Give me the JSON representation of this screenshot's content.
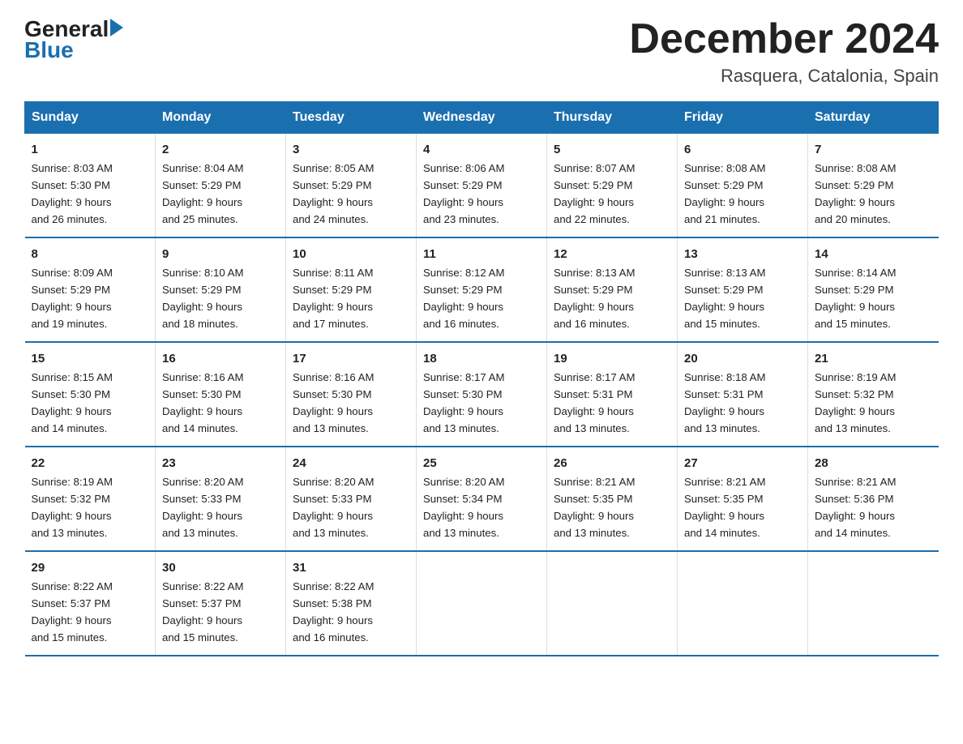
{
  "header": {
    "title": "December 2024",
    "subtitle": "Rasquera, Catalonia, Spain",
    "logo_general": "General",
    "logo_blue": "Blue"
  },
  "days_of_week": [
    "Sunday",
    "Monday",
    "Tuesday",
    "Wednesday",
    "Thursday",
    "Friday",
    "Saturday"
  ],
  "weeks": [
    [
      {
        "day": "1",
        "sunrise": "8:03 AM",
        "sunset": "5:30 PM",
        "daylight": "9 hours and 26 minutes."
      },
      {
        "day": "2",
        "sunrise": "8:04 AM",
        "sunset": "5:29 PM",
        "daylight": "9 hours and 25 minutes."
      },
      {
        "day": "3",
        "sunrise": "8:05 AM",
        "sunset": "5:29 PM",
        "daylight": "9 hours and 24 minutes."
      },
      {
        "day": "4",
        "sunrise": "8:06 AM",
        "sunset": "5:29 PM",
        "daylight": "9 hours and 23 minutes."
      },
      {
        "day": "5",
        "sunrise": "8:07 AM",
        "sunset": "5:29 PM",
        "daylight": "9 hours and 22 minutes."
      },
      {
        "day": "6",
        "sunrise": "8:08 AM",
        "sunset": "5:29 PM",
        "daylight": "9 hours and 21 minutes."
      },
      {
        "day": "7",
        "sunrise": "8:08 AM",
        "sunset": "5:29 PM",
        "daylight": "9 hours and 20 minutes."
      }
    ],
    [
      {
        "day": "8",
        "sunrise": "8:09 AM",
        "sunset": "5:29 PM",
        "daylight": "9 hours and 19 minutes."
      },
      {
        "day": "9",
        "sunrise": "8:10 AM",
        "sunset": "5:29 PM",
        "daylight": "9 hours and 18 minutes."
      },
      {
        "day": "10",
        "sunrise": "8:11 AM",
        "sunset": "5:29 PM",
        "daylight": "9 hours and 17 minutes."
      },
      {
        "day": "11",
        "sunrise": "8:12 AM",
        "sunset": "5:29 PM",
        "daylight": "9 hours and 16 minutes."
      },
      {
        "day": "12",
        "sunrise": "8:13 AM",
        "sunset": "5:29 PM",
        "daylight": "9 hours and 16 minutes."
      },
      {
        "day": "13",
        "sunrise": "8:13 AM",
        "sunset": "5:29 PM",
        "daylight": "9 hours and 15 minutes."
      },
      {
        "day": "14",
        "sunrise": "8:14 AM",
        "sunset": "5:29 PM",
        "daylight": "9 hours and 15 minutes."
      }
    ],
    [
      {
        "day": "15",
        "sunrise": "8:15 AM",
        "sunset": "5:30 PM",
        "daylight": "9 hours and 14 minutes."
      },
      {
        "day": "16",
        "sunrise": "8:16 AM",
        "sunset": "5:30 PM",
        "daylight": "9 hours and 14 minutes."
      },
      {
        "day": "17",
        "sunrise": "8:16 AM",
        "sunset": "5:30 PM",
        "daylight": "9 hours and 13 minutes."
      },
      {
        "day": "18",
        "sunrise": "8:17 AM",
        "sunset": "5:30 PM",
        "daylight": "9 hours and 13 minutes."
      },
      {
        "day": "19",
        "sunrise": "8:17 AM",
        "sunset": "5:31 PM",
        "daylight": "9 hours and 13 minutes."
      },
      {
        "day": "20",
        "sunrise": "8:18 AM",
        "sunset": "5:31 PM",
        "daylight": "9 hours and 13 minutes."
      },
      {
        "day": "21",
        "sunrise": "8:19 AM",
        "sunset": "5:32 PM",
        "daylight": "9 hours and 13 minutes."
      }
    ],
    [
      {
        "day": "22",
        "sunrise": "8:19 AM",
        "sunset": "5:32 PM",
        "daylight": "9 hours and 13 minutes."
      },
      {
        "day": "23",
        "sunrise": "8:20 AM",
        "sunset": "5:33 PM",
        "daylight": "9 hours and 13 minutes."
      },
      {
        "day": "24",
        "sunrise": "8:20 AM",
        "sunset": "5:33 PM",
        "daylight": "9 hours and 13 minutes."
      },
      {
        "day": "25",
        "sunrise": "8:20 AM",
        "sunset": "5:34 PM",
        "daylight": "9 hours and 13 minutes."
      },
      {
        "day": "26",
        "sunrise": "8:21 AM",
        "sunset": "5:35 PM",
        "daylight": "9 hours and 13 minutes."
      },
      {
        "day": "27",
        "sunrise": "8:21 AM",
        "sunset": "5:35 PM",
        "daylight": "9 hours and 14 minutes."
      },
      {
        "day": "28",
        "sunrise": "8:21 AM",
        "sunset": "5:36 PM",
        "daylight": "9 hours and 14 minutes."
      }
    ],
    [
      {
        "day": "29",
        "sunrise": "8:22 AM",
        "sunset": "5:37 PM",
        "daylight": "9 hours and 15 minutes."
      },
      {
        "day": "30",
        "sunrise": "8:22 AM",
        "sunset": "5:37 PM",
        "daylight": "9 hours and 15 minutes."
      },
      {
        "day": "31",
        "sunrise": "8:22 AM",
        "sunset": "5:38 PM",
        "daylight": "9 hours and 16 minutes."
      },
      null,
      null,
      null,
      null
    ]
  ],
  "labels": {
    "sunrise": "Sunrise:",
    "sunset": "Sunset:",
    "daylight": "Daylight:"
  }
}
